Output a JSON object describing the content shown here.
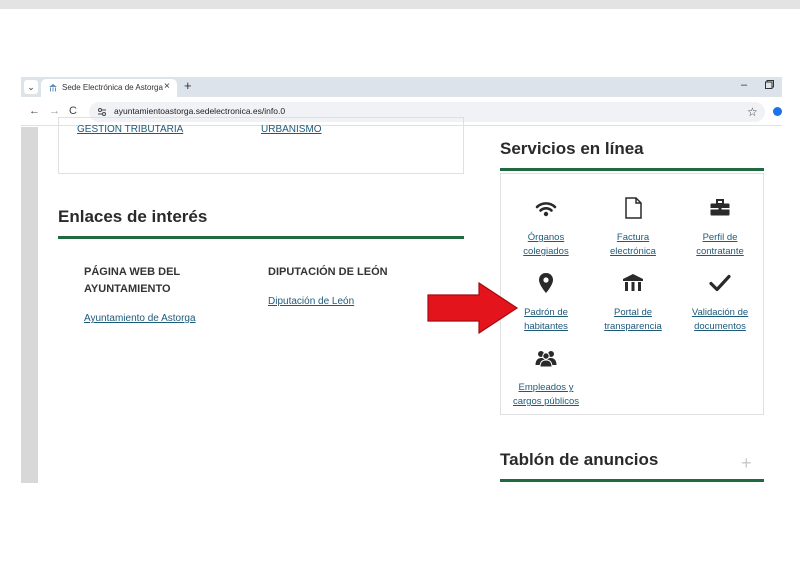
{
  "browser": {
    "tab_title": "Sede Electrónica de Astorga",
    "close_glyph": "×",
    "new_tab_glyph": "+",
    "menu_glyph": "⌄",
    "minimize_glyph": "–",
    "back_glyph": "←",
    "forward_glyph": "→",
    "reload_glyph": "C",
    "bookmark_glyph": "☆",
    "url": "ayuntamientoastorga.sedelectronica.es/info.0"
  },
  "top_menu": {
    "links": [
      "GESTION TRIBUTARIA",
      "URBANISMO"
    ]
  },
  "links_section": {
    "title": "Enlaces de interés",
    "col1": {
      "heading_line1": "PÁGINA WEB DEL",
      "heading_line2": "AYUNTAMIENTO",
      "link": "Ayuntamiento de Astorga"
    },
    "col2": {
      "heading": "DIPUTACIÓN DE LEÓN",
      "link": "Diputación de León"
    }
  },
  "services_section": {
    "title": "Servicios en línea",
    "items": [
      {
        "icon": "wifi-signal-icon",
        "line1": "Órganos",
        "line2": "colegiados"
      },
      {
        "icon": "document-icon",
        "line1": "Factura",
        "line2": "electrónica"
      },
      {
        "icon": "briefcase-icon",
        "line1": "Perfil de",
        "line2": "contratante"
      },
      {
        "icon": "map-pin-icon",
        "line1": "Padrón de",
        "line2": "habitantes"
      },
      {
        "icon": "institution-icon",
        "line1": "Portal de",
        "line2": "transparencia"
      },
      {
        "icon": "checkmark-icon",
        "line1": "Validación de",
        "line2": "documentos"
      },
      {
        "icon": "people-icon",
        "line1": "Empleados y",
        "line2": "cargos públicos"
      }
    ]
  },
  "announcements": {
    "title": "Tablón de anuncios",
    "expand_glyph": "+"
  },
  "colors": {
    "accent_green": "#1f6a3f",
    "link_blue": "#1e5a7a",
    "annotation_arrow": "#e3141b"
  }
}
